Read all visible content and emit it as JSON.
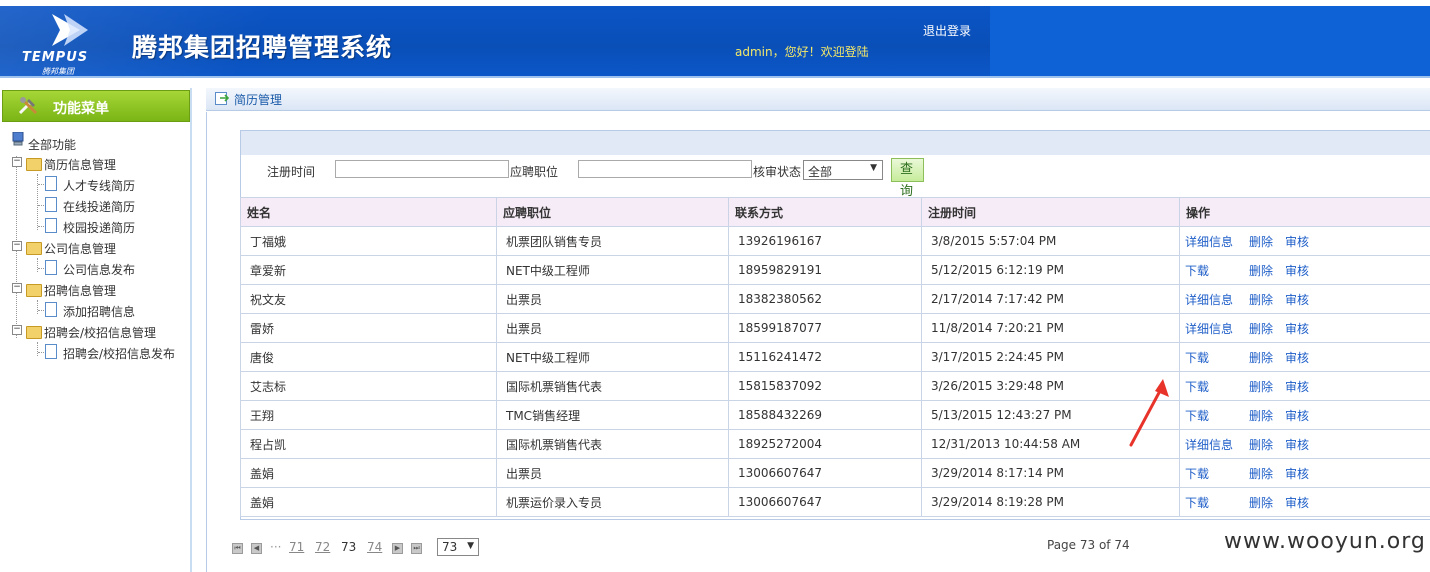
{
  "header": {
    "logo_text": "TEMPUS",
    "logo_sub": "腾邦集团",
    "title": "腾邦集团招聘管理系统",
    "welcome": "admin，您好！欢迎登陆",
    "logout": "退出登录"
  },
  "sidebar": {
    "menu_title": "功能菜单",
    "root": "全部功能",
    "groups": [
      {
        "label": "简历信息管理",
        "items": [
          "人才专线简历",
          "在线投递简历",
          "校园投递简历"
        ]
      },
      {
        "label": "公司信息管理",
        "items": [
          "公司信息发布"
        ]
      },
      {
        "label": "招聘信息管理",
        "items": [
          "添加招聘信息"
        ]
      },
      {
        "label": "招聘会/校招信息管理",
        "items": [
          "招聘会/校招信息发布"
        ]
      }
    ]
  },
  "main": {
    "tab_label": "简历管理",
    "search": {
      "reg_time_label": "注册时间",
      "reg_time_value": "",
      "position_label": "应聘职位",
      "position_value": "",
      "status_label": "核审状态",
      "status_value": "全部",
      "query_button": "查 询"
    },
    "table": {
      "headers": [
        "姓名",
        "应聘职位",
        "联系方式",
        "注册时间",
        "操作"
      ],
      "rows": [
        {
          "name": "丁福娥",
          "position": "机票团队销售专员",
          "phone": "13926196167",
          "time": "3/8/2015 5:57:04 PM",
          "op1": "详细信息",
          "op2": "删除",
          "op3": "审核"
        },
        {
          "name": "章爱新",
          "position": "NET中级工程师",
          "phone": "18959829191",
          "time": "5/12/2015 6:12:19 PM",
          "op1": "下载",
          "op2": "删除",
          "op3": "审核"
        },
        {
          "name": "祝文友",
          "position": "出票员",
          "phone": "18382380562",
          "time": "2/17/2014 7:17:42 PM",
          "op1": "详细信息",
          "op2": "删除",
          "op3": "审核"
        },
        {
          "name": "雷娇",
          "position": "出票员",
          "phone": "18599187077",
          "time": "11/8/2014 7:20:21 PM",
          "op1": "详细信息",
          "op2": "删除",
          "op3": "审核"
        },
        {
          "name": "唐俊",
          "position": "NET中级工程师",
          "phone": "15116241472",
          "time": "3/17/2015 2:24:45 PM",
          "op1": "下载",
          "op2": "删除",
          "op3": "审核"
        },
        {
          "name": "艾志标",
          "position": "国际机票销售代表",
          "phone": "15815837092",
          "time": "3/26/2015 3:29:48 PM",
          "op1": "下载",
          "op2": "删除",
          "op3": "审核"
        },
        {
          "name": "王翔",
          "position": "TMC销售经理",
          "phone": "18588432269",
          "time": "5/13/2015 12:43:27 PM",
          "op1": "下载",
          "op2": "删除",
          "op3": "审核"
        },
        {
          "name": "程占凯",
          "position": "国际机票销售代表",
          "phone": "18925272004",
          "time": "12/31/2013 10:44:58 AM",
          "op1": "详细信息",
          "op2": "删除",
          "op3": "审核"
        },
        {
          "name": "盖娟",
          "position": "出票员",
          "phone": "13006607647",
          "time": "3/29/2014 8:17:14 PM",
          "op1": "下载",
          "op2": "删除",
          "op3": "审核"
        },
        {
          "name": "盖娟",
          "position": "机票运价录入专员",
          "phone": "13006607647",
          "time": "3/29/2014 8:19:28 PM",
          "op1": "下载",
          "op2": "删除",
          "op3": "审核"
        }
      ]
    },
    "pager": {
      "ellipsis": "···",
      "pages": [
        "71",
        "72",
        "73",
        "74"
      ],
      "current": "73",
      "select_value": "73",
      "info": "Page 73 of 74"
    }
  },
  "watermark": "www.wooyun.org",
  "colors": {
    "header_blue": "#0b55c7",
    "menu_green": "#8cc325",
    "link_blue": "#1e5ec8",
    "welcome_yellow": "#f3e86a",
    "table_header_bg": "#f6ecf7",
    "annotation_red": "#e8332a"
  }
}
